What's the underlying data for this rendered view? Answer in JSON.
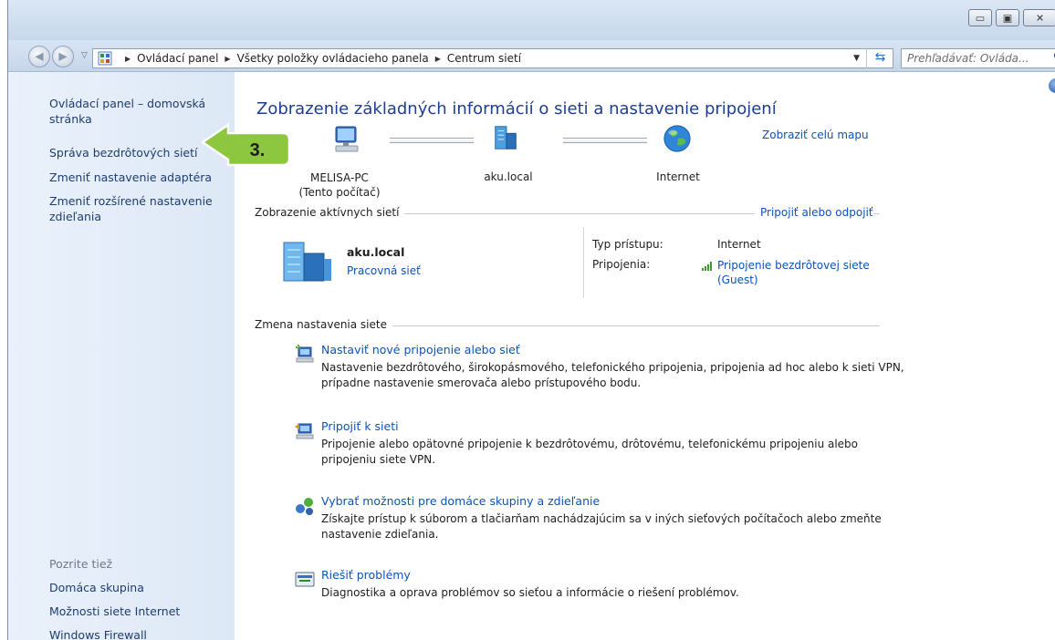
{
  "window": {
    "caption_buttons": [
      "▭",
      "▣",
      "✕"
    ]
  },
  "toolbar": {
    "breadcrumbs": [
      "Ovládací panel",
      "Všetky položky ovládacieho panela",
      "Centrum sietí"
    ],
    "search_placeholder": "Prehľadávať: Ovláda..."
  },
  "sidebar": {
    "home_link": "Ovládací panel – domovská stránka",
    "links": [
      "Správa bezdrôtových sietí",
      "Zmeniť nastavenie adaptéra",
      "Zmeniť rozšírené nastavenie zdieľania"
    ],
    "see_also_title": "Pozrite tiež",
    "see_also": [
      "Domáca skupina",
      "Možnosti siete Internet",
      "Windows Firewall"
    ]
  },
  "callout": {
    "label": "3.",
    "color": "#8dc63f"
  },
  "main": {
    "title": "Zobrazenie základných informácií o sieti a nastavenie pripojení",
    "map_link": "Zobraziť celú mapu",
    "map_nodes": {
      "pc_name": "MELISA-PC",
      "pc_note": "(Tento počítač)",
      "network": "aku.local",
      "internet": "Internet"
    },
    "active_networks": {
      "label": "Zobrazenie aktívnych sietí",
      "connect_link": "Pripojiť alebo odpojiť",
      "network_name": "aku.local",
      "network_type": "Pracovná sieť",
      "access_type_label": "Typ prístupu:",
      "access_type_value": "Internet",
      "connections_label": "Pripojenia:",
      "connection_value_line1": "Pripojenie bezdrôtovej siete",
      "connection_value_line2": "(Guest)"
    },
    "change_settings": {
      "label": "Zmena nastavenia siete",
      "tasks": [
        {
          "title": "Nastaviť nové pripojenie alebo sieť",
          "desc": "Nastavenie bezdrôtového, širokopásmového, telefonického pripojenia, pripojenia ad hoc alebo k sieti VPN, prípadne nastavenie smerovača alebo prístupového bodu."
        },
        {
          "title": "Pripojiť k sieti",
          "desc": "Pripojenie alebo opätovné pripojenie k bezdrôtovému, drôtovému, telefonickému pripojeniu alebo pripojeniu siete VPN."
        },
        {
          "title": "Vybrať možnosti pre domáce skupiny a zdieľanie",
          "desc": "Získajte prístup k súborom a tlačiarňam nachádzajúcim sa v iných sieťových počítačoch alebo zmeňte nastavenie zdieľania."
        },
        {
          "title": "Riešiť problémy",
          "desc": "Diagnostika a oprava problémov so sieťou a informácie o riešení problémov."
        }
      ]
    }
  }
}
